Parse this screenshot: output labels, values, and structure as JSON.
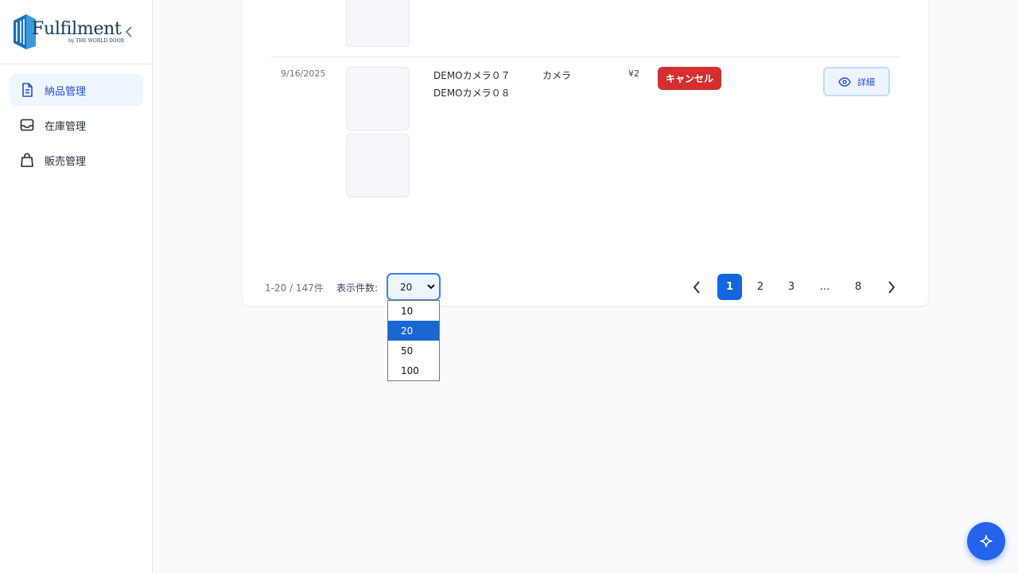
{
  "brand": {
    "name": "Fulfilment",
    "tagline": "by THE WORLD DOOR"
  },
  "sidebar": {
    "items": [
      {
        "label": "納品管理",
        "icon": "document-icon",
        "active": true
      },
      {
        "label": "在庫管理",
        "icon": "inbox-icon",
        "active": false
      },
      {
        "label": "販売管理",
        "icon": "shopping-bag-icon",
        "active": false
      }
    ]
  },
  "table": {
    "row": {
      "date": "9/16/2025",
      "products": [
        "DEMOカメラ０７",
        "DEMOカメラ０８"
      ],
      "category": "カメラ",
      "price": "¥2",
      "status": "キャンセル",
      "action_label": "詳細"
    }
  },
  "pagination": {
    "summary": "1-20 / 147件",
    "per_page_label": "表示件数:",
    "per_page_value": "20",
    "per_page_options": [
      "10",
      "20",
      "50",
      "100"
    ],
    "pages": [
      "1",
      "2",
      "3",
      "...",
      "8"
    ],
    "current_page": "1"
  },
  "colors": {
    "accent": "#1266e0",
    "status_cancel": "#d32f2f",
    "fab": "#2563eb"
  }
}
